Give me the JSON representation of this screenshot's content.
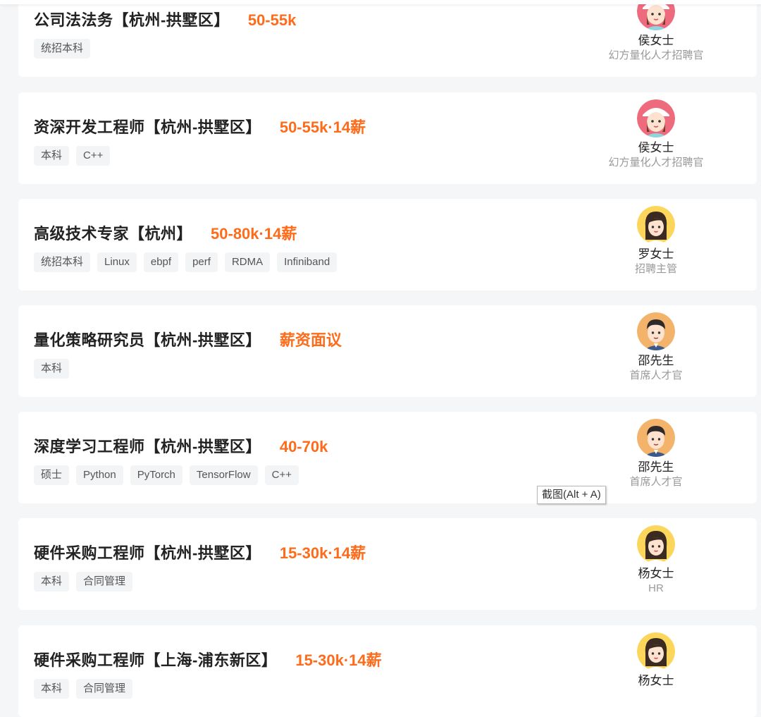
{
  "tooltip": "截图(Alt + A)",
  "colors": {
    "salary": "#fe6b1a",
    "card_bg": "#ffffff",
    "page_bg": "#f5f6f8",
    "tag_bg": "#f3f4f6"
  },
  "jobs": [
    {
      "title": "公司法法务【杭州-拱墅区】",
      "salary": "50-55k",
      "tags": [
        "统招本科"
      ],
      "recruiter": {
        "name": "侯女士",
        "title": "幻方量化人才招聘官",
        "avatar": "female-cap-avatar-icon"
      }
    },
    {
      "title": "资深开发工程师【杭州-拱墅区】",
      "salary": "50-55k·14薪",
      "tags": [
        "本科",
        "C++"
      ],
      "recruiter": {
        "name": "侯女士",
        "title": "幻方量化人才招聘官",
        "avatar": "female-cap-avatar-icon"
      }
    },
    {
      "title": "高级技术专家【杭州】",
      "salary": "50-80k·14薪",
      "tags": [
        "统招本科",
        "Linux",
        "ebpf",
        "perf",
        "RDMA",
        "Infiniband"
      ],
      "recruiter": {
        "name": "罗女士",
        "title": "招聘主管",
        "avatar": "female-avatar-icon"
      }
    },
    {
      "title": "量化策略研究员【杭州-拱墅区】",
      "salary": "薪资面议",
      "tags": [
        "本科"
      ],
      "recruiter": {
        "name": "邵先生",
        "title": "首席人才官",
        "avatar": "male-avatar-icon"
      }
    },
    {
      "title": "深度学习工程师【杭州-拱墅区】",
      "salary": "40-70k",
      "tags": [
        "硕士",
        "Python",
        "PyTorch",
        "TensorFlow",
        "C++"
      ],
      "recruiter": {
        "name": "邵先生",
        "title": "首席人才官",
        "avatar": "male-avatar-icon"
      }
    },
    {
      "title": "硬件采购工程师【杭州-拱墅区】",
      "salary": "15-30k·14薪",
      "tags": [
        "本科",
        "合同管理"
      ],
      "recruiter": {
        "name": "杨女士",
        "title": "HR",
        "avatar": "female-avatar-icon"
      }
    },
    {
      "title": "硬件采购工程师【上海-浦东新区】",
      "salary": "15-30k·14薪",
      "tags": [
        "本科",
        "合同管理"
      ],
      "recruiter": {
        "name": "杨女士",
        "title": "",
        "avatar": "female-avatar-icon"
      }
    }
  ]
}
